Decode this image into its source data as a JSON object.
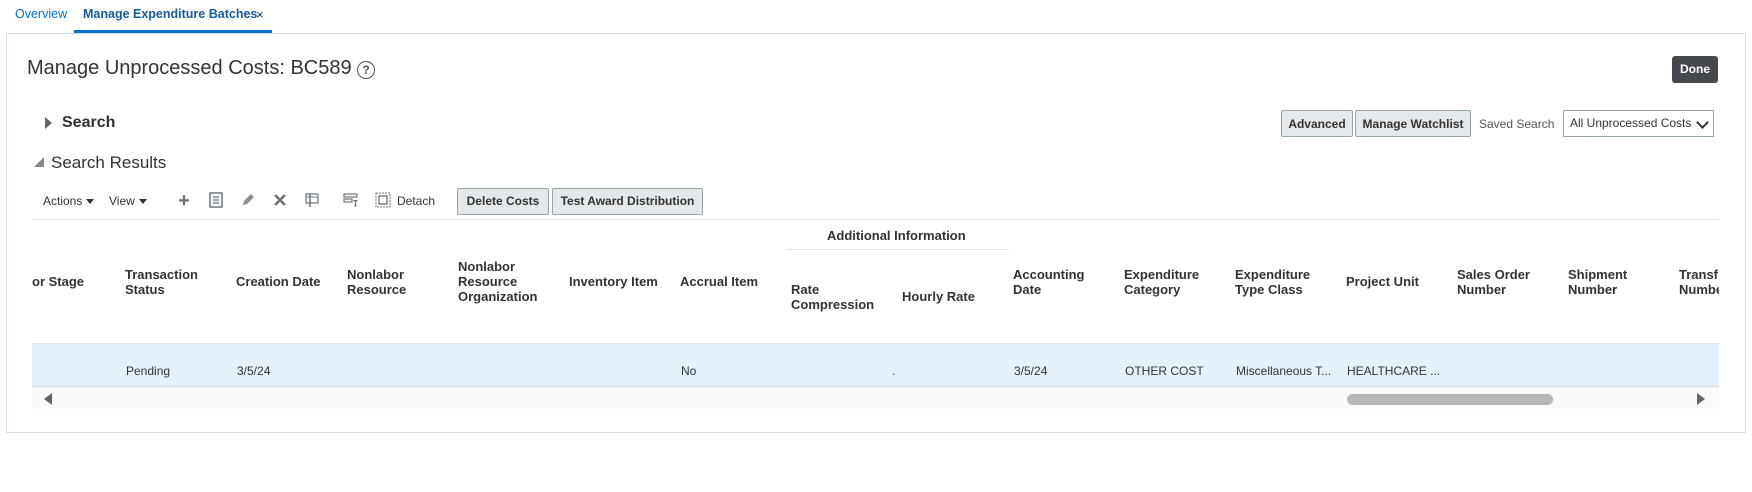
{
  "tabs": {
    "overview": "Overview",
    "active": "Manage Expenditure Batches",
    "close_glyph": "×"
  },
  "header": {
    "title": "Manage Unprocessed Costs: BC589",
    "help_glyph": "?",
    "done_label": "Done"
  },
  "search": {
    "label": "Search",
    "advanced_label": "Advanced",
    "watchlist_label": "Manage Watchlist",
    "saved_search_label": "Saved Search",
    "saved_search_value": "All Unprocessed Costs"
  },
  "results": {
    "label": "Search Results",
    "actions_label": "Actions",
    "view_label": "View",
    "detach_label": "Detach",
    "delete_costs_label": "Delete Costs",
    "test_award_label": "Test Award Distribution",
    "icons": [
      "add-icon",
      "details-icon",
      "edit-icon",
      "delete-icon",
      "freeze-icon",
      "query-by-example-icon",
      "detach-icon"
    ]
  },
  "table": {
    "group_header": "Additional Information",
    "columns": [
      "or Stage",
      "Transaction Status",
      "Creation Date",
      "Nonlabor Resource",
      "Nonlabor Resource Organization",
      "Inventory Item",
      "Accrual Item",
      "Rate Compression",
      "Hourly Rate",
      "Accounting Date",
      "Expenditure Category",
      "Expenditure Type Class",
      "Project Unit",
      "Sales Order Number",
      "Shipment Number",
      "Transf Numbe"
    ],
    "rows": [
      {
        "transaction_status": "Pending",
        "creation_date": "3/5/24",
        "accrual_item": "No",
        "hourly_rate": ".",
        "accounting_date": "3/5/24",
        "expenditure_category": "OTHER COST",
        "expenditure_type_class": "Miscellaneous T...",
        "project_unit": "HEALTHCARE ..."
      }
    ]
  }
}
